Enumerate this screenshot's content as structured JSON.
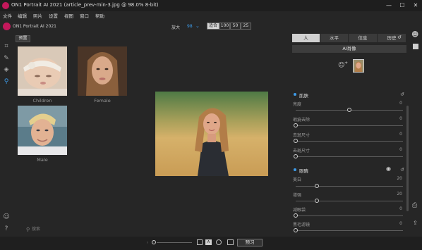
{
  "window": {
    "title": "ON1 Portrait AI 2021 (article_prev-min-3.jpg @ 98.0% 8-bit)",
    "minimize": "—",
    "maximize": "☐",
    "close": "✕"
  },
  "menu": [
    "文件",
    "编辑",
    "照片",
    "设置",
    "视图",
    "窗口",
    "帮助"
  ],
  "brand": "ON1 Portrait AI 2021",
  "toolbar": {
    "zoom_label": "放大",
    "zoom_value": "98",
    "zoom_buttons": [
      "适合",
      "100",
      "50",
      "25"
    ]
  },
  "presets": {
    "tab_label": "预置",
    "items": [
      {
        "label": "Children"
      },
      {
        "label": "Female"
      },
      {
        "label": "Male"
      }
    ],
    "search_placeholder": "搜索"
  },
  "right_panel": {
    "tabs": [
      "人",
      "水平",
      "信息",
      "历史"
    ],
    "ai_match_label": "AI肖像",
    "skin_section": {
      "title": "肌肤",
      "sliders": [
        {
          "label": "亮度",
          "value": "0",
          "fraction": 0.5
        },
        {
          "label": "瑕疵去除",
          "value": "0",
          "fraction": 0.0
        },
        {
          "label": "去斑尺寸",
          "value": "0",
          "fraction": 0.0
        },
        {
          "label": "去斑尺寸",
          "value": "0",
          "fraction": 0.0
        }
      ]
    },
    "eyes_section": {
      "title": "眼睛",
      "sliders": [
        {
          "label": "美白",
          "value": "20",
          "fraction": 0.2
        },
        {
          "label": "增强",
          "value": "20",
          "fraction": 0.2
        },
        {
          "label": "减眼袋",
          "value": "0",
          "fraction": 0.0
        },
        {
          "label": "黑毛滤镜",
          "value": "0",
          "fraction": 0.0
        }
      ]
    }
  },
  "bottom": {
    "preview_label": "预习"
  },
  "colors": {
    "accent": "#3d9be9",
    "brand": "#c2185b"
  }
}
